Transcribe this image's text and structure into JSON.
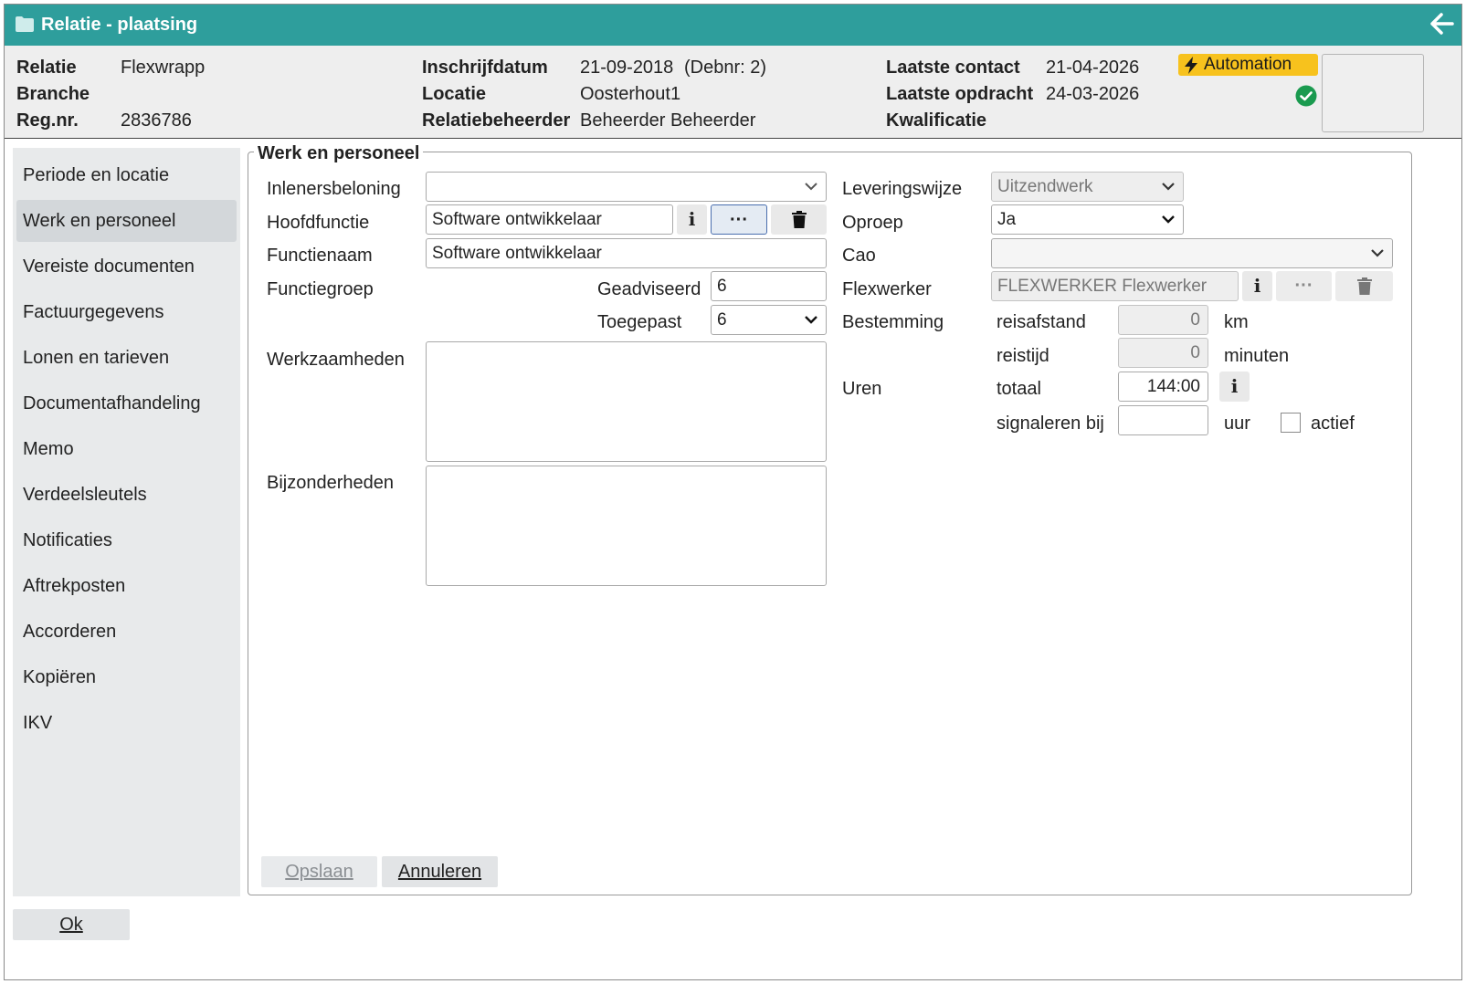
{
  "window": {
    "title": "Relatie - plaatsing"
  },
  "header": {
    "relatie_label": "Relatie",
    "relatie_value": "Flexwrapp",
    "branche_label": "Branche",
    "branche_value": "",
    "regnr_label": "Reg.nr.",
    "regnr_value": "2836786",
    "inschrijfdatum_label": "Inschrijfdatum",
    "inschrijfdatum_value": "21-09-2018",
    "debnr_value": "(Debnr: 2)",
    "locatie_label": "Locatie",
    "locatie_value": "Oosterhout1",
    "relatiebeheerder_label": "Relatiebeheerder",
    "relatiebeheerder_value": "Beheerder Beheerder",
    "laatste_contact_label": "Laatste contact",
    "laatste_contact_value": "21-04-2026",
    "laatste_opdracht_label": "Laatste opdracht",
    "laatste_opdracht_value": "24-03-2026",
    "kwalificatie_label": "Kwalificatie",
    "kwalificatie_value": "",
    "automation_label": "Automation",
    "status_color": "#1a9a4f",
    "automation_color": "#f7c21d"
  },
  "sidebar": {
    "items": [
      {
        "label": "Periode en locatie",
        "active": false
      },
      {
        "label": "Werk en personeel",
        "active": true
      },
      {
        "label": "Vereiste documenten",
        "active": false
      },
      {
        "label": "Factuurgegevens",
        "active": false
      },
      {
        "label": "Lonen en tarieven",
        "active": false
      },
      {
        "label": "Documentafhandeling",
        "active": false
      },
      {
        "label": "Memo",
        "active": false
      },
      {
        "label": "Verdeelsleutels",
        "active": false
      },
      {
        "label": "Notificaties",
        "active": false
      },
      {
        "label": "Aftrekposten",
        "active": false
      },
      {
        "label": "Accorderen",
        "active": false
      },
      {
        "label": "Kopiëren",
        "active": false
      },
      {
        "label": "IKV",
        "active": false
      }
    ]
  },
  "form": {
    "legend": "Werk en personeel",
    "inlenersbeloning_label": "Inlenersbeloning",
    "inlenersbeloning_value": "",
    "hoofdfunctie_label": "Hoofdfunctie",
    "hoofdfunctie_value": "Software ontwikkelaar",
    "functienaam_label": "Functienaam",
    "functienaam_value": "Software ontwikkelaar",
    "functiegroep_label": "Functiegroep",
    "geadviseerd_label": "Geadviseerd",
    "geadviseerd_value": "6",
    "toegepast_label": "Toegepast",
    "toegepast_value": "6",
    "werkzaamheden_label": "Werkzaamheden",
    "bijzonderheden_label": "Bijzonderheden",
    "leveringswijze_label": "Leveringswijze",
    "leveringswijze_value": "Uitzendwerk",
    "oproep_label": "Oproep",
    "oproep_value": "Ja",
    "cao_label": "Cao",
    "cao_value": "",
    "flexwerker_label": "Flexwerker",
    "flexwerker_value": "FLEXWERKER Flexwerker",
    "bestemming_label": "Bestemming",
    "reisafstand_label": "reisafstand",
    "reisafstand_value": "0",
    "km_label": "km",
    "reistijd_label": "reistijd",
    "reistijd_value": "0",
    "minuten_label": "minuten",
    "uren_label": "Uren",
    "totaal_label": "totaal",
    "totaal_value": "144:00",
    "signaleren_label": "signaleren bij",
    "signaleren_value": "",
    "uur_label": "uur",
    "actief_label": "actief",
    "info_glyph": "i",
    "more_glyph": "···"
  },
  "footer": {
    "opslaan_label": "Opslaan",
    "annuleren_label": "Annuleren",
    "ok_label": "Ok"
  }
}
